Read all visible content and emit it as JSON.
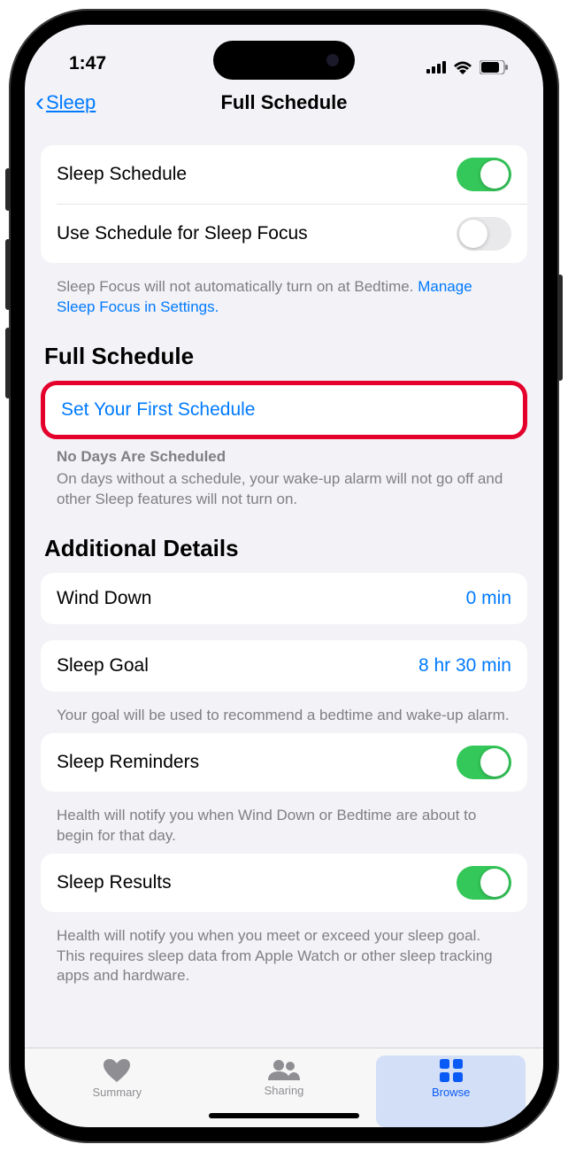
{
  "status": {
    "time": "1:47"
  },
  "nav": {
    "back": "Sleep",
    "title": "Full Schedule"
  },
  "settings": {
    "sleepSchedule": {
      "label": "Sleep Schedule",
      "enabled": true
    },
    "useForFocus": {
      "label": "Use Schedule for Sleep Focus",
      "enabled": false
    },
    "focusFooter": "Sleep Focus will not automatically turn on at Bedtime.",
    "focusLink": "Manage Sleep Focus in Settings."
  },
  "fullSchedule": {
    "header": "Full Schedule",
    "setFirst": "Set Your First Schedule",
    "noDaysTitle": "No Days Are Scheduled",
    "noDaysBody": "On days without a schedule, your wake-up alarm will not go off and other Sleep features will not turn on."
  },
  "additional": {
    "header": "Additional Details",
    "windDown": {
      "label": "Wind Down",
      "value": "0 min"
    },
    "sleepGoal": {
      "label": "Sleep Goal",
      "value": "8 hr 30 min",
      "footer": "Your goal will be used to recommend a bedtime and wake-up alarm."
    },
    "reminders": {
      "label": "Sleep Reminders",
      "enabled": true,
      "footer": "Health will notify you when Wind Down or Bedtime are about to begin for that day."
    },
    "results": {
      "label": "Sleep Results",
      "enabled": true,
      "footer": "Health will notify you when you meet or exceed your sleep goal. This requires sleep data from Apple Watch or other sleep tracking apps and hardware."
    }
  },
  "tabs": {
    "summary": "Summary",
    "sharing": "Sharing",
    "browse": "Browse"
  }
}
